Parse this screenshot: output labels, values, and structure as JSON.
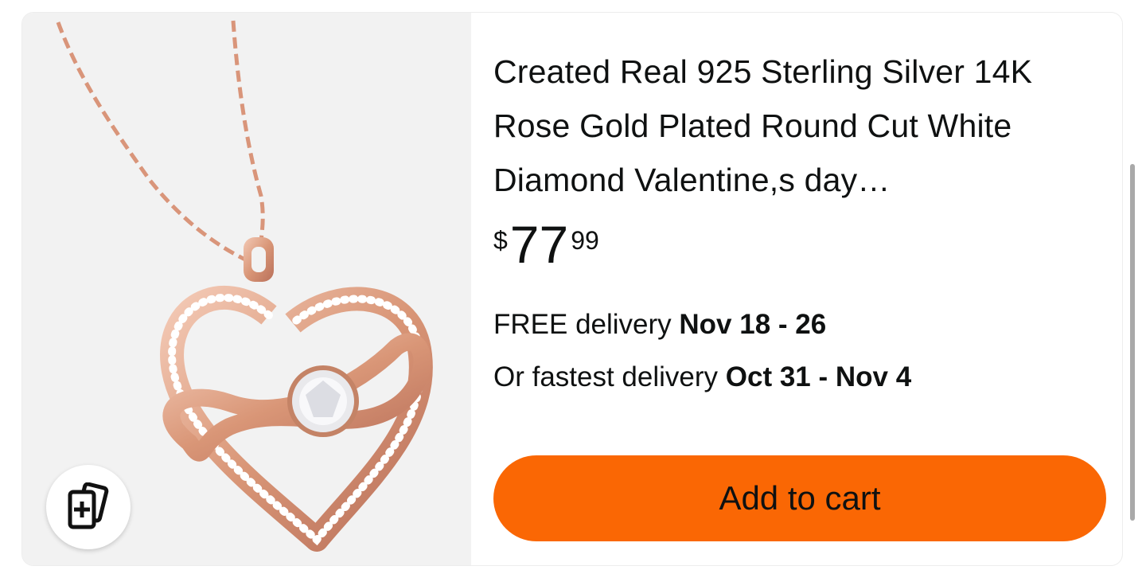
{
  "product": {
    "title": "Created Real 925 Sterling Silver 14K Rose Gold Plated Round Cut White Diamond Valentine,s day…",
    "price": {
      "symbol": "$",
      "whole": "77",
      "fraction": "99"
    },
    "delivery": {
      "free_prefix": "FREE delivery ",
      "free_dates": "Nov 18 - 26",
      "fast_prefix": "Or fastest delivery ",
      "fast_dates": "Oct 31 - Nov 4"
    },
    "add_to_cart_label": "Add to cart",
    "image_icon": "heart-infinity-necklace"
  },
  "controls": {
    "compare_icon": "add-to-compare-icon"
  },
  "colors": {
    "button_bg": "#fa6704",
    "text": "#0f1111",
    "image_bg": "#f2f2f2",
    "rose_gold": "#e2a387"
  }
}
